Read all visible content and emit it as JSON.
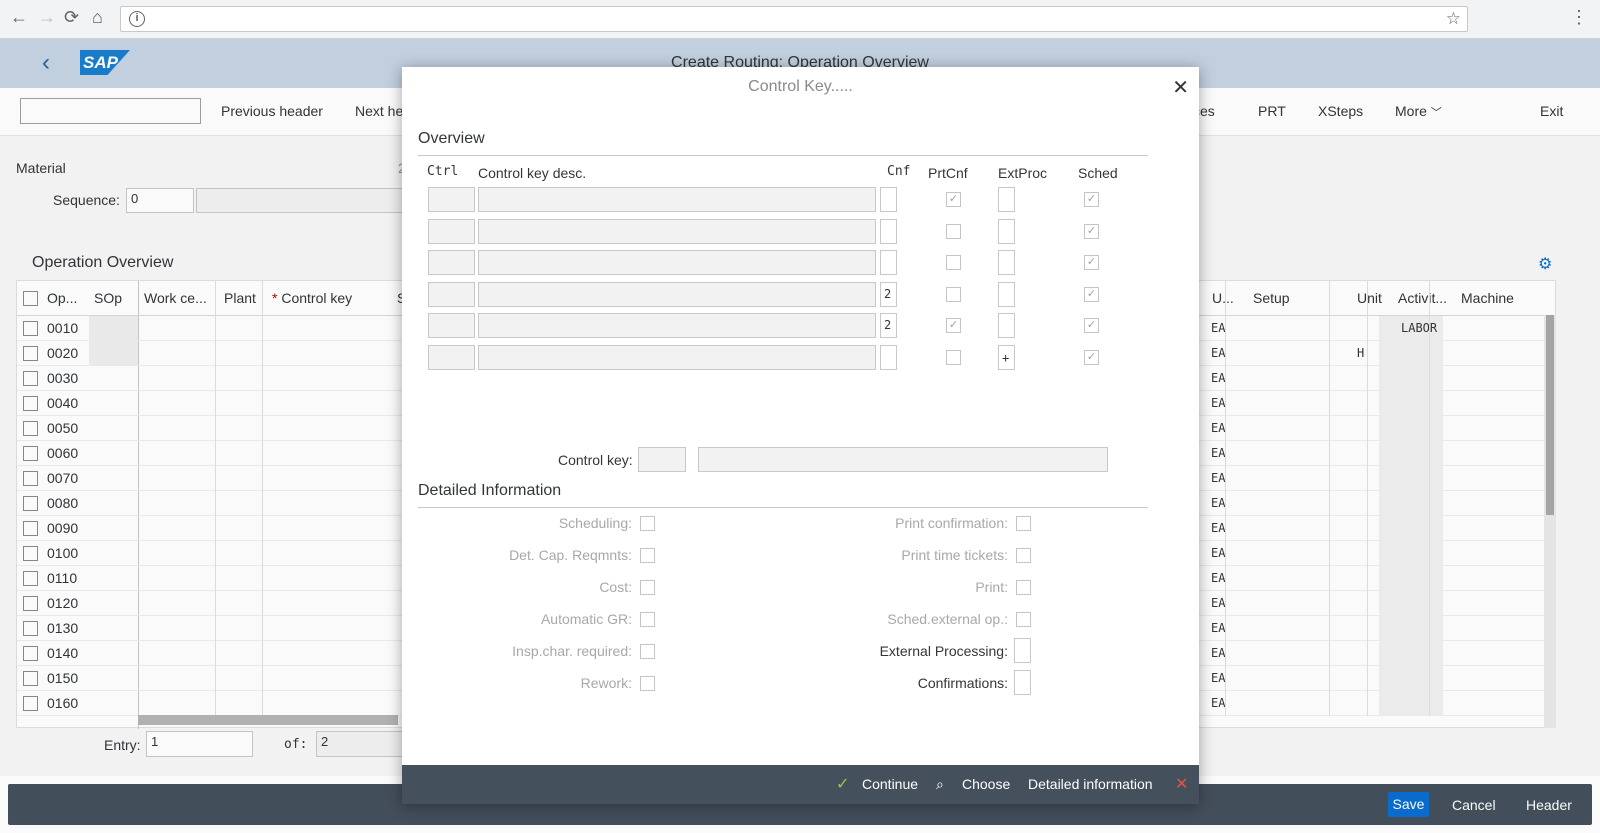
{
  "shell": {
    "title": "Create Routing: Operation Overview",
    "logo": "SAP"
  },
  "toolbar": {
    "command_value": "",
    "prev_header": "Previous header",
    "next_header": "Next he",
    "ces": "ces",
    "prt": "PRT",
    "xsteps": "XSteps",
    "more": "More",
    "exit": "Exit"
  },
  "header": {
    "material_label": "Material",
    "sequence_label": "Sequence:",
    "sequence_value": "0",
    "trunc_char": "2"
  },
  "grid": {
    "title": "Operation Overview",
    "cols": {
      "op": "Op...",
      "sop": "SOp",
      "workcenter": "Work ce...",
      "plant": "Plant",
      "control_key": "Control key",
      "required_mark": "*",
      "s": "S",
      "u": "U...",
      "setup": "Setup",
      "unit": "Unit",
      "activity": "Activit...",
      "machine": "Machine"
    },
    "rows": [
      {
        "op": "0010",
        "u": "EA",
        "unit": "",
        "activity": "LABOR"
      },
      {
        "op": "0020",
        "u": "EA",
        "unit": "H",
        "activity": ""
      },
      {
        "op": "0030",
        "u": "EA",
        "unit": "",
        "activity": ""
      },
      {
        "op": "0040",
        "u": "EA",
        "unit": "",
        "activity": ""
      },
      {
        "op": "0050",
        "u": "EA",
        "unit": "",
        "activity": ""
      },
      {
        "op": "0060",
        "u": "EA",
        "unit": "",
        "activity": ""
      },
      {
        "op": "0070",
        "u": "EA",
        "unit": "",
        "activity": ""
      },
      {
        "op": "0080",
        "u": "EA",
        "unit": "",
        "activity": ""
      },
      {
        "op": "0090",
        "u": "EA",
        "unit": "",
        "activity": ""
      },
      {
        "op": "0100",
        "u": "EA",
        "unit": "",
        "activity": ""
      },
      {
        "op": "0110",
        "u": "EA",
        "unit": "",
        "activity": ""
      },
      {
        "op": "0120",
        "u": "EA",
        "unit": "",
        "activity": ""
      },
      {
        "op": "0130",
        "u": "EA",
        "unit": "",
        "activity": ""
      },
      {
        "op": "0140",
        "u": "EA",
        "unit": "",
        "activity": ""
      },
      {
        "op": "0150",
        "u": "EA",
        "unit": "",
        "activity": ""
      },
      {
        "op": "0160",
        "u": "EA",
        "unit": "",
        "activity": ""
      }
    ],
    "entry_label": "Entry:",
    "entry_value": "1",
    "of_label": "of:",
    "of_value": "2"
  },
  "footer": {
    "save": "Save",
    "cancel": "Cancel",
    "header": "Header"
  },
  "dialog": {
    "title": "Control Key.....",
    "overview": "Overview",
    "cols": {
      "ctrl": "Ctrl",
      "desc": "Control key desc.",
      "cnf": "Cnf",
      "prtcnf": "PrtCnf",
      "extproc": "ExtProc",
      "sched": "Sched"
    },
    "rows": [
      {
        "cnf": "",
        "prtcnf": true,
        "extproc": "",
        "sched": true
      },
      {
        "cnf": "",
        "prtcnf": false,
        "extproc": "",
        "sched": true
      },
      {
        "cnf": "",
        "prtcnf": false,
        "extproc": "",
        "sched": true
      },
      {
        "cnf": "2",
        "prtcnf": false,
        "extproc": "",
        "sched": true
      },
      {
        "cnf": "2",
        "prtcnf": true,
        "extproc": "",
        "sched": true
      },
      {
        "cnf": "",
        "prtcnf": false,
        "extproc": "+",
        "sched": true
      }
    ],
    "control_key_label": "Control key:",
    "detailed": "Detailed Information",
    "left_fields": [
      "Scheduling:",
      "Det. Cap. Reqmnts:",
      "Cost:",
      "Automatic GR:",
      "Insp.char. required:",
      "Rework:"
    ],
    "right_fields": [
      "Print confirmation:",
      "Print time tickets:",
      "Print:",
      "Sched.external op.:",
      "External Processing:",
      "Confirmations:"
    ],
    "footer": {
      "continue": "Continue",
      "choose": "Choose",
      "detailed_info": "Detailed information"
    }
  }
}
